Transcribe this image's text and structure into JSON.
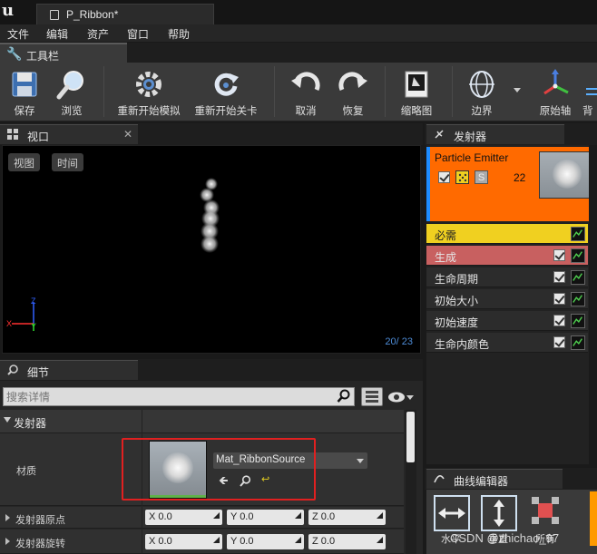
{
  "window": {
    "tab_title": "P_Ribbon*"
  },
  "menu": [
    "文件",
    "编辑",
    "资产",
    "窗口",
    "帮助"
  ],
  "toolbar": {
    "tab_label": "工具栏",
    "buttons": {
      "save": "保存",
      "browse": "浏览",
      "restart_sim": "重新开始模拟",
      "restart_level": "重新开始关卡",
      "undo": "取消",
      "redo": "恢复",
      "thumbnail": "缩略图",
      "bounds": "边界",
      "origin_axis": "原始轴",
      "background": "背"
    }
  },
  "viewport": {
    "tab_label": "视口",
    "btn_view": "视图",
    "btn_time": "时间",
    "counter": "20/ 23",
    "axis_x": "X",
    "axis_y": "Y",
    "axis_z": "Z"
  },
  "details": {
    "tab_label": "细节",
    "search_placeholder": "搜索详情",
    "section": "发射器",
    "material_label": "材质",
    "material_value": "Mat_RibbonSource",
    "origin_label": "发射器原点",
    "rotation_label": "发射器旋转",
    "origin": {
      "x": "X 0.0",
      "y": "Y 0.0",
      "z": "Z 0.0"
    },
    "rotation": {
      "x": "X 0.0",
      "y": "Y 0.0",
      "z": "Z 0.0"
    }
  },
  "emitters": {
    "tab_label": "发射器",
    "name": "Particle Emitter",
    "count": "22",
    "s_badge": "S",
    "modules": [
      "必需",
      "生成",
      "生命周期",
      "初始大小",
      "初始速度",
      "生命内颜色"
    ]
  },
  "curve_editor": {
    "tab_label": "曲线编辑器",
    "btn_horizontal": "水平",
    "btn_vertical": "垂直",
    "btn_all": "所有"
  },
  "watermark": "CSDN @zhichao_97",
  "colors": {
    "emitter_header": "#ff6a00",
    "required_row": "#f0d020",
    "spawn_row": "#c86060",
    "highlight_box": "#e02020",
    "viewport_counter": "#4d8bd6"
  }
}
